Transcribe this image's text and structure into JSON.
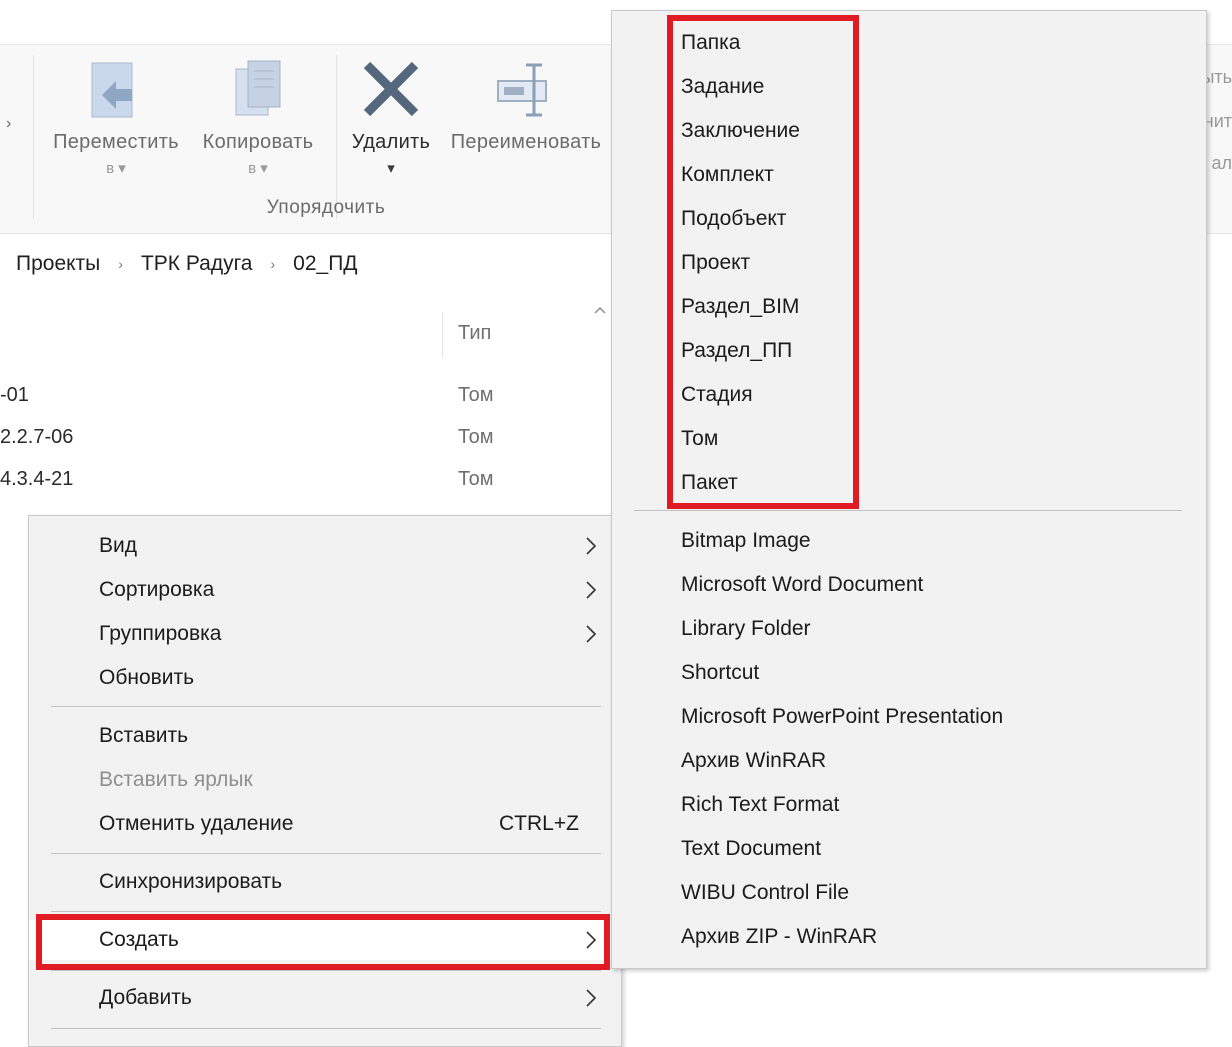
{
  "ribbon": {
    "left_cut": "›",
    "buttons": {
      "move": {
        "label": "Переместить",
        "sub": "в ▾"
      },
      "copy": {
        "label": "Копировать",
        "sub": "в ▾"
      },
      "delete": {
        "label": "Удалить",
        "sub": "▾"
      },
      "rename": {
        "label": "Переименовать"
      }
    },
    "group_label": "Упорядочить",
    "right_cut": [
      "ыть",
      "нит",
      "ал"
    ]
  },
  "breadcrumb": [
    "Проекты",
    "ТРК Радуга",
    "02_ПД"
  ],
  "breadcrumb_sep": "›",
  "file_list": {
    "type_header": "Тип",
    "rows": [
      {
        "name": "-01",
        "type": "Том"
      },
      {
        "name": "2.2.7-06",
        "type": "Том"
      },
      {
        "name": "4.3.4-21",
        "type": "Том"
      }
    ]
  },
  "context_menu": {
    "items": [
      {
        "label": "Вид",
        "submenu": true
      },
      {
        "label": "Сортировка",
        "submenu": true
      },
      {
        "label": "Группировка",
        "submenu": true
      },
      {
        "label": "Обновить"
      },
      {
        "label": "Вставить"
      },
      {
        "label": "Вставить ярлык",
        "disabled": true
      },
      {
        "label": "Отменить удаление",
        "shortcut": "CTRL+Z"
      },
      {
        "label": "Синхронизировать"
      },
      {
        "label": "Создать",
        "submenu": true,
        "highlighted": true
      },
      {
        "label": "Добавить",
        "submenu": true
      }
    ]
  },
  "new_submenu": {
    "custom_items": [
      "Папка",
      "Задание",
      "Заключение",
      "Комплект",
      "Подобъект",
      "Проект",
      "Раздел_BIM",
      "Раздел_ПП",
      "Стадия",
      "Том",
      "Пакет"
    ],
    "standard_items": [
      "Bitmap Image",
      "Microsoft Word Document",
      "Library Folder",
      "Shortcut",
      "Microsoft PowerPoint Presentation",
      "Архив WinRAR",
      "Rich Text Format",
      "Text Document",
      "WIBU Control File",
      "Архив ZIP - WinRAR"
    ]
  },
  "colors": {
    "highlight_box": "#e01b24",
    "menu_bg": "#f2f2f2"
  }
}
